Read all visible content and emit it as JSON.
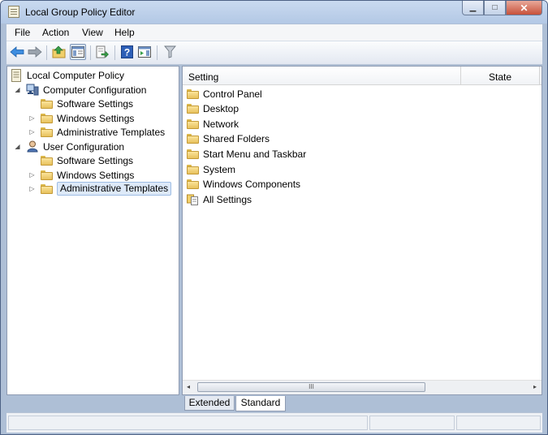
{
  "window": {
    "title": "Local Group Policy Editor",
    "minimize_glyph": "▁",
    "maximize_glyph": "□",
    "close_glyph": "✕"
  },
  "menu": {
    "file": "File",
    "action": "Action",
    "view": "View",
    "help": "Help"
  },
  "toolbar": {
    "icons": [
      "back-arrow-icon",
      "forward-arrow-icon",
      "up-one-level-icon",
      "show-hide-console-tree-icon",
      "export-list-icon",
      "help-icon",
      "show-hide-action-pane-icon",
      "filter-icon"
    ]
  },
  "tree": {
    "root": "Local Computer Policy",
    "computer_config": "Computer Configuration",
    "cc_software": "Software Settings",
    "cc_windows": "Windows Settings",
    "cc_admin": "Administrative Templates",
    "user_config": "User Configuration",
    "uc_software": "Software Settings",
    "uc_windows": "Windows Settings",
    "uc_admin": "Administrative Templates"
  },
  "list": {
    "col_setting": "Setting",
    "col_state": "State",
    "items": [
      "Control Panel",
      "Desktop",
      "Network",
      "Shared Folders",
      "Start Menu and Taskbar",
      "System",
      "Windows Components",
      "All Settings"
    ]
  },
  "scroll": {
    "left": "◂",
    "right": "▸",
    "grip": "III"
  },
  "tabs": {
    "extended": "Extended",
    "standard": "Standard",
    "active": "Standard"
  },
  "colors": {
    "folder": "#e7c15d",
    "selection": "#dde9f8",
    "frame": "#aebfd6"
  }
}
